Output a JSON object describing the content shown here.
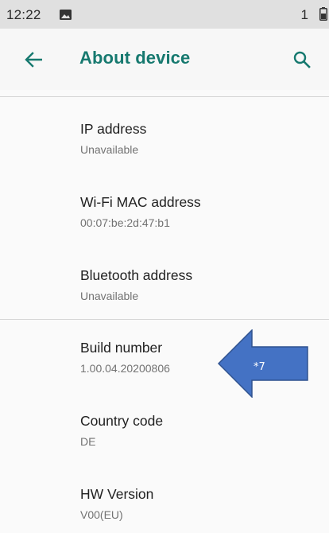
{
  "status_bar": {
    "time": "12:22",
    "sim_indicator": "1",
    "icons": [
      "image-notification-icon",
      "battery-icon"
    ]
  },
  "toolbar": {
    "back_icon": "arrow-left-icon",
    "title": "About device",
    "search_icon": "search-icon",
    "accent_color": "#16796f"
  },
  "items": [
    {
      "title": "IP address",
      "summary": "Unavailable"
    },
    {
      "title": "Wi-Fi MAC address",
      "summary": "00:07:be:2d:47:b1"
    },
    {
      "title": "Bluetooth address",
      "summary": "Unavailable"
    },
    {
      "title": "Build number",
      "summary": "1.00.04.20200806"
    },
    {
      "title": "Country code",
      "summary": "DE"
    },
    {
      "title": "HW Version",
      "summary": "V00(EU)"
    }
  ],
  "annotation": {
    "label": "*7",
    "color": "#4472c4"
  }
}
